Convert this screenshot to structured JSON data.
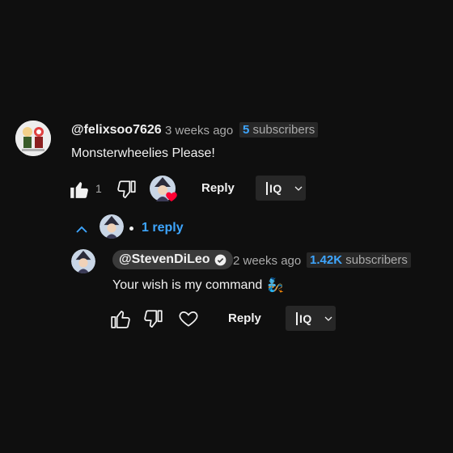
{
  "comment": {
    "author": "@felixsoo7626",
    "time": "3 weeks ago",
    "subs_count": "5",
    "subs_label": "subscribers",
    "text": "Monsterwheelies Please!",
    "like_count": "1",
    "reply_label": "Reply",
    "iq_label": "IQ"
  },
  "replies_toggle": {
    "label": "1 reply"
  },
  "reply": {
    "author": "@StevenDiLeo",
    "time": "2 weeks ago",
    "subs_count": "1.42K",
    "subs_label": "subscribers",
    "text": "Your wish is my command",
    "emoji": "🧞",
    "reply_label": "Reply",
    "iq_label": "IQ"
  },
  "colors": {
    "background": "#0f0f0f",
    "link": "#3ea6ff",
    "heart": "#ff0033"
  }
}
